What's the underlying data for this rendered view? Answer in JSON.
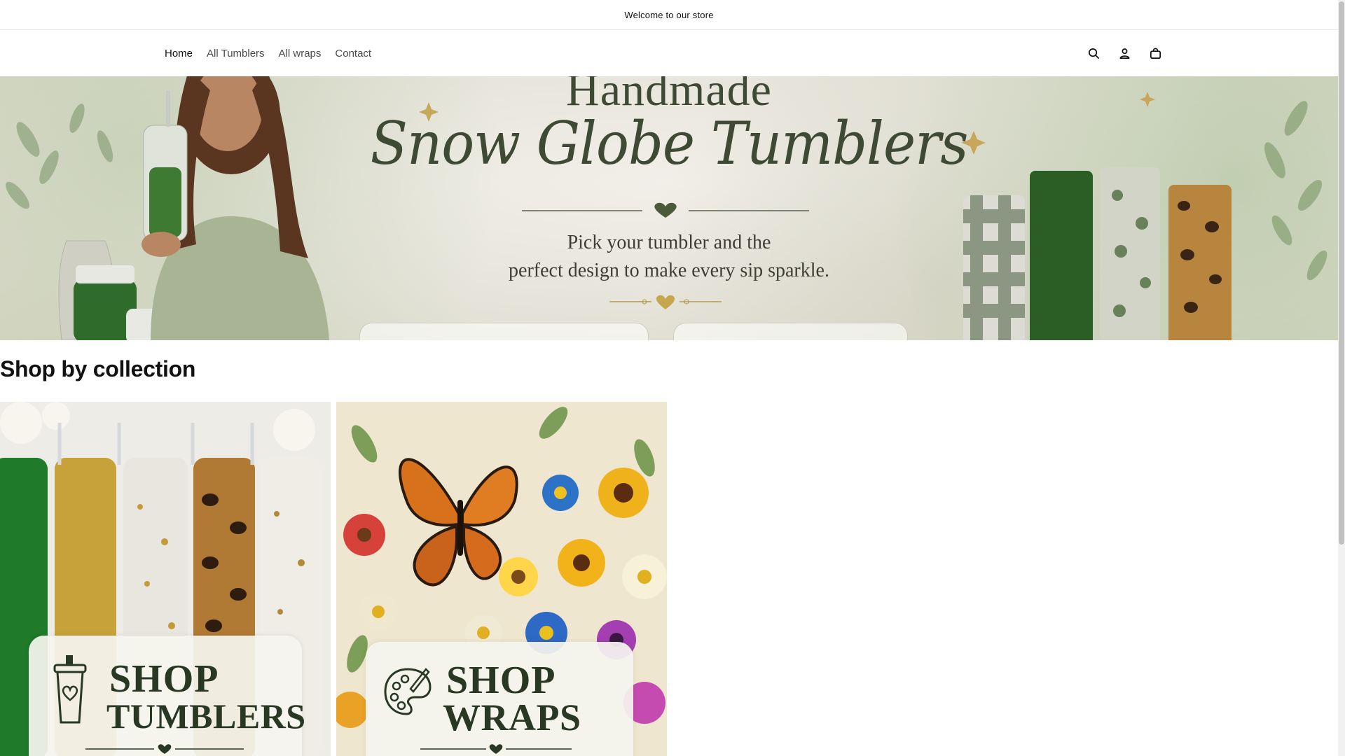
{
  "announcement": {
    "text": "Welcome to our store"
  },
  "header": {
    "nav": [
      {
        "label": "Home",
        "active": true
      },
      {
        "label": "All Tumblers",
        "active": false
      },
      {
        "label": "All wraps",
        "active": false
      },
      {
        "label": "Contact",
        "active": false
      }
    ],
    "icons": [
      "search-icon",
      "account-icon",
      "cart-icon"
    ]
  },
  "hero": {
    "title_top": "Handmade",
    "title_script": "Snow Globe Tumblers",
    "subtitle_line1": "Pick your tumbler and the",
    "subtitle_line2": "perfect design to make every sip sparkle."
  },
  "collections": {
    "title": "Shop by collection",
    "cards": [
      {
        "line1": "SHOP",
        "line2": "TUMBLERS",
        "icon": "tumbler-icon"
      },
      {
        "line1": "SHOP",
        "line2": "WRAPS",
        "icon": "palette-icon"
      }
    ]
  },
  "colors": {
    "text": "#121212",
    "nav_text": "#4a4a4a",
    "hero_green": "#3e4a33",
    "card_green": "#283822"
  }
}
